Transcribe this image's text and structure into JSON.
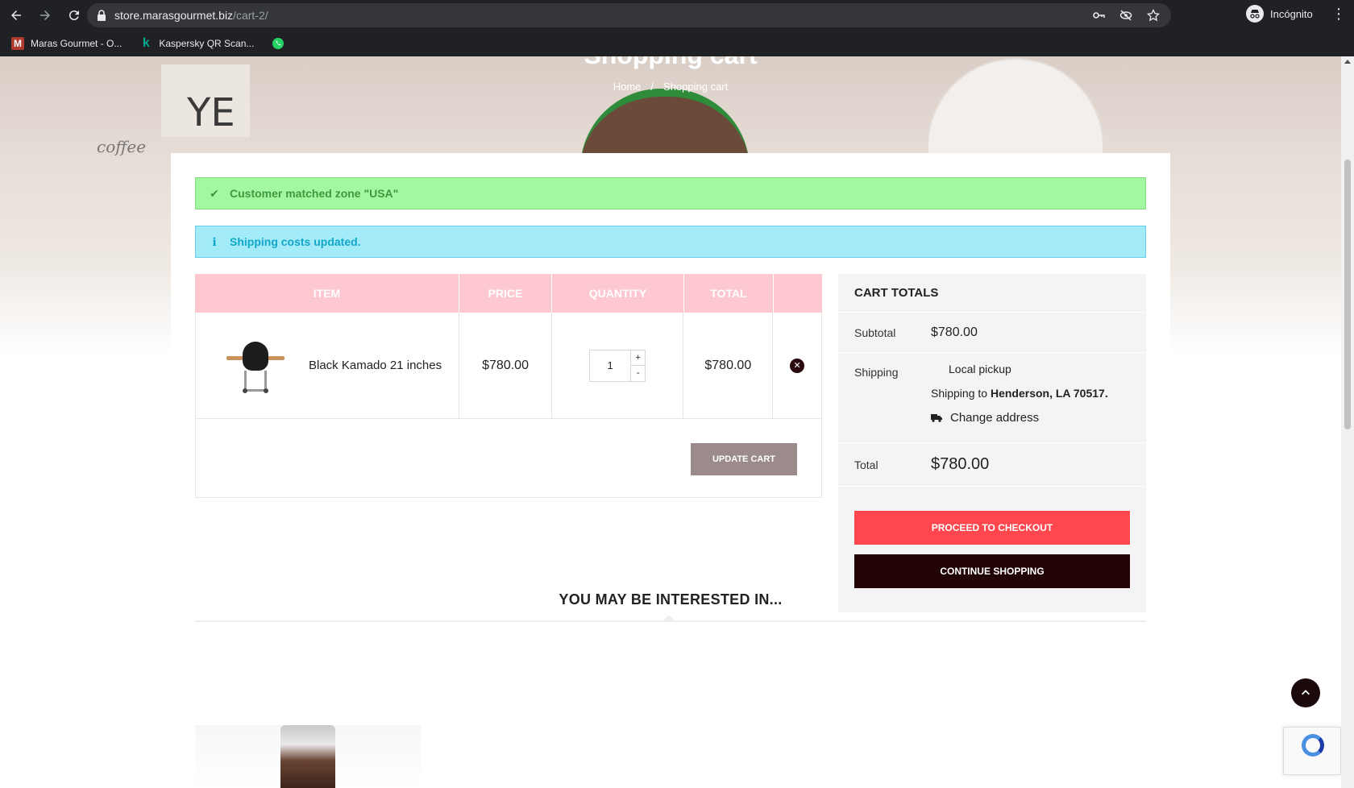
{
  "browser": {
    "url_host": "store.marasgourmet.biz",
    "url_path": "/cart-2/",
    "profile_label": "Incógnito",
    "bookmarks": [
      {
        "label": "Maras Gourmet - O...",
        "icon": "maras-favicon",
        "color": "#b03a2e",
        "glyph": "M"
      },
      {
        "label": "Kaspersky QR Scan...",
        "icon": "kaspersky-favicon",
        "color": "#00a88e",
        "glyph": "k"
      },
      {
        "label": "",
        "icon": "whatsapp-favicon",
        "color": "#25d366",
        "glyph": ""
      }
    ]
  },
  "hero": {
    "title": "Shopping cart",
    "breadcrumb": {
      "home": "Home",
      "separator": "/",
      "current": "Shopping cart"
    }
  },
  "notices": {
    "success": {
      "icon": "check-icon",
      "text": "Customer matched zone \"USA\""
    },
    "info": {
      "icon": "info-icon",
      "text": "Shipping costs updated."
    }
  },
  "cart": {
    "headers": {
      "item": "ITEM",
      "price": "PRICE",
      "quantity": "QUANTITY",
      "total": "TOTAL"
    },
    "rows": [
      {
        "name": "Black Kamado 21 inches",
        "price": "$780.00",
        "quantity": "1",
        "total": "$780.00"
      }
    ],
    "qty_plus": "+",
    "qty_minus": "-",
    "update_label": "UPDATE CART"
  },
  "totals": {
    "title": "CART TOTALS",
    "subtotal_label": "Subtotal",
    "subtotal_value": "$780.00",
    "shipping_label": "Shipping",
    "shipping_method": "Local pickup",
    "shipping_to_prefix": "Shipping to",
    "shipping_to_location": "Henderson, LA 70517.",
    "change_address": "Change address",
    "total_label": "Total",
    "total_value": "$780.00",
    "checkout_label": "PROCEED TO CHECKOUT",
    "continue_label": "CONTINUE SHOPPING"
  },
  "interest": {
    "title": "YOU MAY BE INTERESTED IN..."
  },
  "colors": {
    "table_header": "#fec8d0",
    "checkout": "#ff474d",
    "continue": "#220407",
    "update": "#9c8b8b",
    "success_bg": "#a3f7a0",
    "info_bg": "#a3ebf9"
  }
}
